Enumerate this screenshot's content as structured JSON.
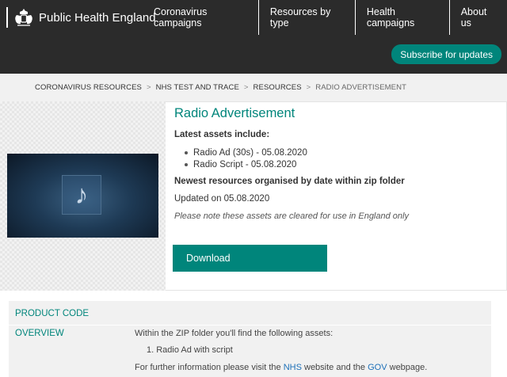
{
  "header": {
    "brand": "Public Health England",
    "nav": [
      "Coronavirus campaigns",
      "Resources by type",
      "Health campaigns",
      "About us"
    ],
    "subscribe_label": "Subscribe for updates"
  },
  "breadcrumb": {
    "items": [
      "CORONAVIRUS RESOURCES",
      "NHS TEST AND TRACE",
      "RESOURCES"
    ],
    "separator": ">",
    "current": "RADIO ADVERTISEMENT"
  },
  "product": {
    "title": "Radio Advertisement",
    "latest_heading": "Latest assets include:",
    "assets": [
      "Radio Ad (30s) - 05.08.2020",
      "Radio Script - 05.08.2020"
    ],
    "newest_note": "Newest resources organised by date within zip folder",
    "updated": "Updated on 05.08.2020",
    "notice": "Please note these assets are cleared for use in England only",
    "download_label": "Download",
    "thumbnail_icon": "music-note-icon",
    "thumbnail_glyph": "♪"
  },
  "details": {
    "product_code_label": "PRODUCT CODE",
    "overview_label": "OVERVIEW",
    "overview_intro": "Within the ZIP folder you'll find the following assets:",
    "overview_items": [
      "1. Radio Ad with script"
    ],
    "further_prefix": "For further information please visit the ",
    "further_link1": "NHS",
    "further_middle": " website and the ",
    "further_link2": "GOV",
    "further_suffix": " webpage."
  },
  "colors": {
    "header_bg": "#2b2b2b",
    "accent": "#00857b",
    "link": "#1d70b8"
  }
}
